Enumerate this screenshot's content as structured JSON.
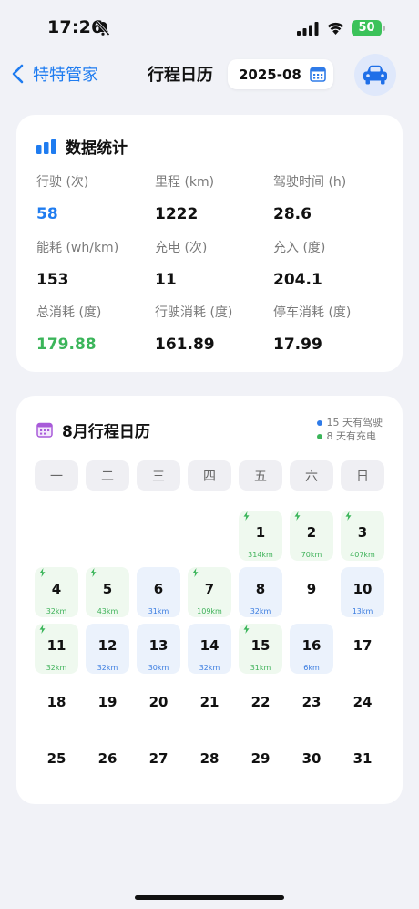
{
  "status_bar": {
    "time": "17:26",
    "battery": "50"
  },
  "nav": {
    "back_label": "特特管家",
    "title": "行程日历",
    "month": "2025-08"
  },
  "stats": {
    "title": "数据统计",
    "items": [
      {
        "label": "行驶 (次)",
        "value": "58",
        "color": "#1f7cf0"
      },
      {
        "label": "里程 (km)",
        "value": "1222",
        "color": "#111111"
      },
      {
        "label": "驾驶时间 (h)",
        "value": "28.6",
        "color": "#111111"
      },
      {
        "label": "能耗 (wh/km)",
        "value": "153",
        "color": "#111111"
      },
      {
        "label": "充电 (次)",
        "value": "11",
        "color": "#111111"
      },
      {
        "label": "充入 (度)",
        "value": "204.1",
        "color": "#111111"
      },
      {
        "label": "总消耗 (度)",
        "value": "179.88",
        "color": "#3bb55a"
      },
      {
        "label": "行驶消耗 (度)",
        "value": "161.89",
        "color": "#111111"
      },
      {
        "label": "停车消耗 (度)",
        "value": "17.99",
        "color": "#111111"
      }
    ]
  },
  "calendar": {
    "title": "8月行程日历",
    "legend": [
      {
        "text": "15 天有驾驶",
        "color": "#2f7be8"
      },
      {
        "text": "8 天有充电",
        "color": "#3bb55a"
      }
    ],
    "weekdays": [
      "一",
      "二",
      "三",
      "四",
      "五",
      "六",
      "日"
    ],
    "first_weekday_index": 4,
    "days": [
      {
        "day": "1",
        "km": "314km",
        "drive": true,
        "charge": true
      },
      {
        "day": "2",
        "km": "70km",
        "drive": true,
        "charge": true
      },
      {
        "day": "3",
        "km": "407km",
        "drive": true,
        "charge": true
      },
      {
        "day": "4",
        "km": "32km",
        "drive": true,
        "charge": true
      },
      {
        "day": "5",
        "km": "43km",
        "drive": true,
        "charge": true
      },
      {
        "day": "6",
        "km": "31km",
        "drive": true,
        "charge": false
      },
      {
        "day": "7",
        "km": "109km",
        "drive": true,
        "charge": true
      },
      {
        "day": "8",
        "km": "32km",
        "drive": true,
        "charge": false
      },
      {
        "day": "9",
        "km": "",
        "drive": false,
        "charge": false
      },
      {
        "day": "10",
        "km": "13km",
        "drive": true,
        "charge": false
      },
      {
        "day": "11",
        "km": "32km",
        "drive": true,
        "charge": true
      },
      {
        "day": "12",
        "km": "32km",
        "drive": true,
        "charge": false
      },
      {
        "day": "13",
        "km": "30km",
        "drive": true,
        "charge": false
      },
      {
        "day": "14",
        "km": "32km",
        "drive": true,
        "charge": false
      },
      {
        "day": "15",
        "km": "31km",
        "drive": true,
        "charge": true
      },
      {
        "day": "16",
        "km": "6km",
        "drive": true,
        "charge": false
      },
      {
        "day": "17",
        "km": "",
        "drive": false,
        "charge": false
      },
      {
        "day": "18",
        "km": "",
        "drive": false,
        "charge": false
      },
      {
        "day": "19",
        "km": "",
        "drive": false,
        "charge": false
      },
      {
        "day": "20",
        "km": "",
        "drive": false,
        "charge": false
      },
      {
        "day": "21",
        "km": "",
        "drive": false,
        "charge": false
      },
      {
        "day": "22",
        "km": "",
        "drive": false,
        "charge": false
      },
      {
        "day": "23",
        "km": "",
        "drive": false,
        "charge": false
      },
      {
        "day": "24",
        "km": "",
        "drive": false,
        "charge": false
      },
      {
        "day": "25",
        "km": "",
        "drive": false,
        "charge": false
      },
      {
        "day": "26",
        "km": "",
        "drive": false,
        "charge": false
      },
      {
        "day": "27",
        "km": "",
        "drive": false,
        "charge": false
      },
      {
        "day": "28",
        "km": "",
        "drive": false,
        "charge": false
      },
      {
        "day": "29",
        "km": "",
        "drive": false,
        "charge": false
      },
      {
        "day": "30",
        "km": "",
        "drive": false,
        "charge": false
      },
      {
        "day": "31",
        "km": "",
        "drive": false,
        "charge": false
      }
    ]
  },
  "icons": {
    "bell": "bell-slash-icon",
    "signal": "cellular-signal-icon",
    "wifi": "wifi-icon",
    "back": "chevron-left-icon",
    "calendar": "calendar-icon",
    "car": "car-icon",
    "stats": "bar-chart-icon",
    "bolt": "lightning-bolt-icon"
  }
}
